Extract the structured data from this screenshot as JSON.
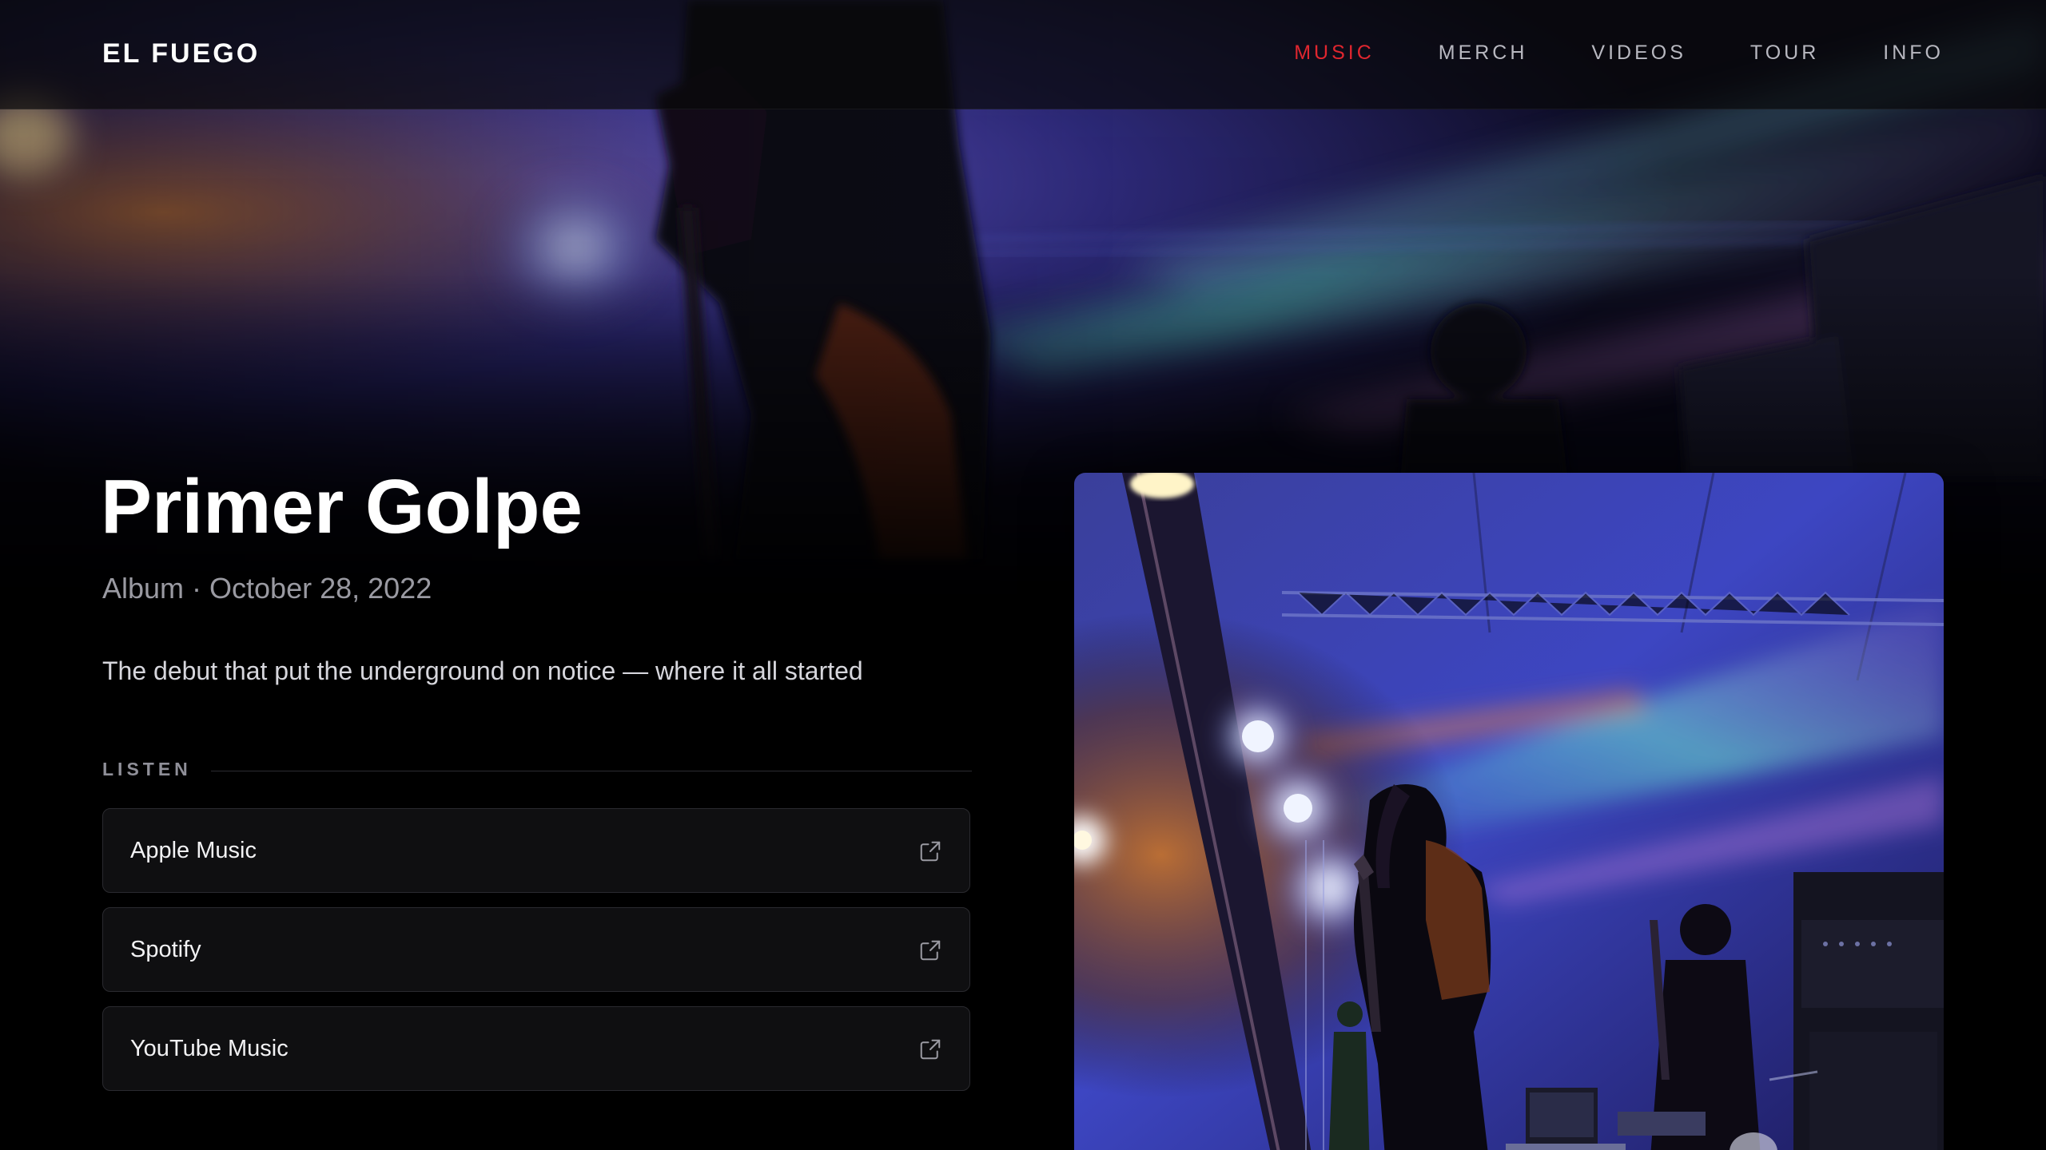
{
  "header": {
    "logo": "EL FUEGO",
    "nav": [
      {
        "label": "MUSIC",
        "active": true
      },
      {
        "label": "MERCH",
        "active": false
      },
      {
        "label": "VIDEOS",
        "active": false
      },
      {
        "label": "TOUR",
        "active": false
      },
      {
        "label": "INFO",
        "active": false
      }
    ]
  },
  "release": {
    "title": "Primer Golpe",
    "meta": "Album · October 28, 2022",
    "tagline": "The debut that put the underground on notice — where it all started"
  },
  "listen": {
    "label": "LISTEN",
    "links": [
      {
        "label": "Apple Music",
        "icon": "external-link-icon"
      },
      {
        "label": "Spotify",
        "icon": "external-link-icon"
      },
      {
        "label": "YouTube Music",
        "icon": "external-link-icon"
      }
    ]
  },
  "colors": {
    "accent": "#e0262f",
    "background": "#000000",
    "card": "#0f0f11"
  }
}
